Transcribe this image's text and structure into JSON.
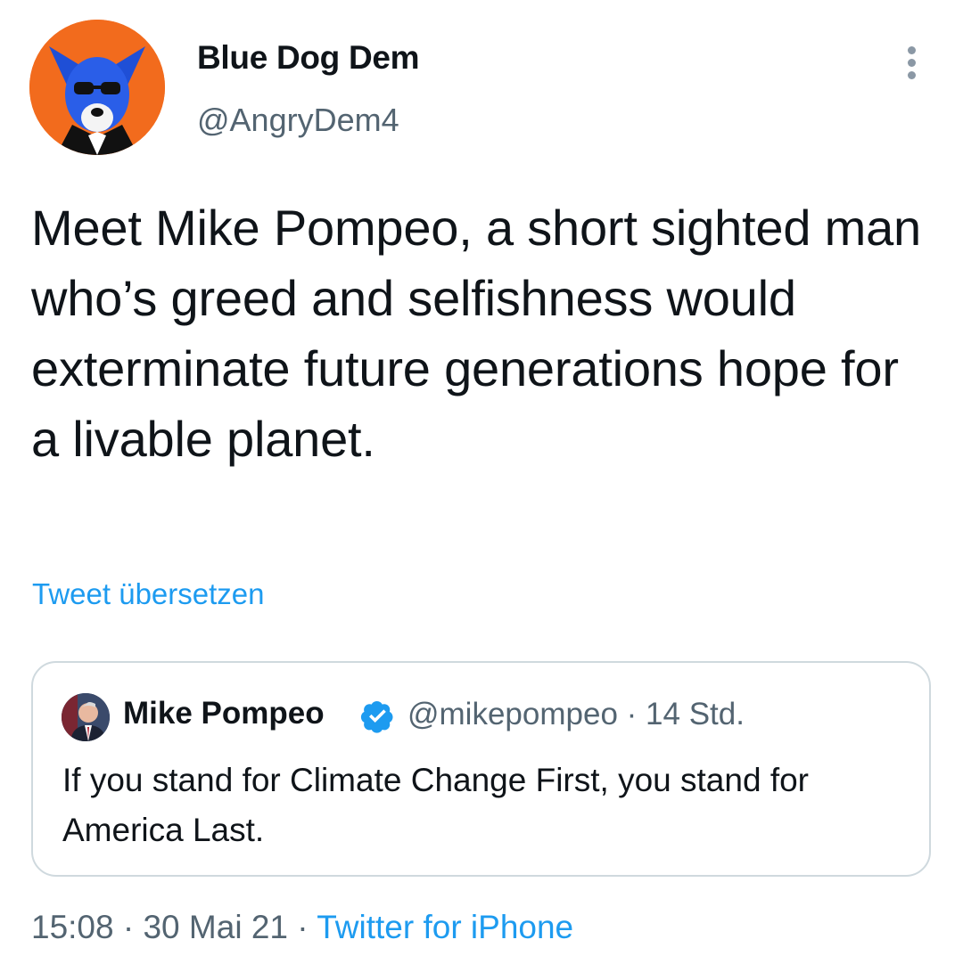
{
  "author": {
    "name": "Blue Dog Dem",
    "handle": "@AngryDem4",
    "avatar_icon": "blue-dog-icon",
    "avatar_bg": "#f26b1d"
  },
  "tweet": {
    "text": "Meet Mike Pompeo, a short sighted man who’s greed and selfishness would exterminate future generations hope for a livable planet.",
    "translate_label": "Tweet übersetzen"
  },
  "quoted": {
    "name": "Mike Pompeo",
    "handle": "@mikepompeo",
    "separator": "·",
    "age": "14 Std.",
    "verified_icon": "verified-badge-icon",
    "text": "If you stand for Climate Change First, you stand for America Last."
  },
  "footer": {
    "time": "15:08",
    "separator_1": "·",
    "date": "30 Mai 21",
    "separator_2": "·",
    "source": "Twitter for iPhone"
  },
  "colors": {
    "accent": "#1d9bf0",
    "secondary_text": "#536471",
    "border": "#cfd9de"
  }
}
